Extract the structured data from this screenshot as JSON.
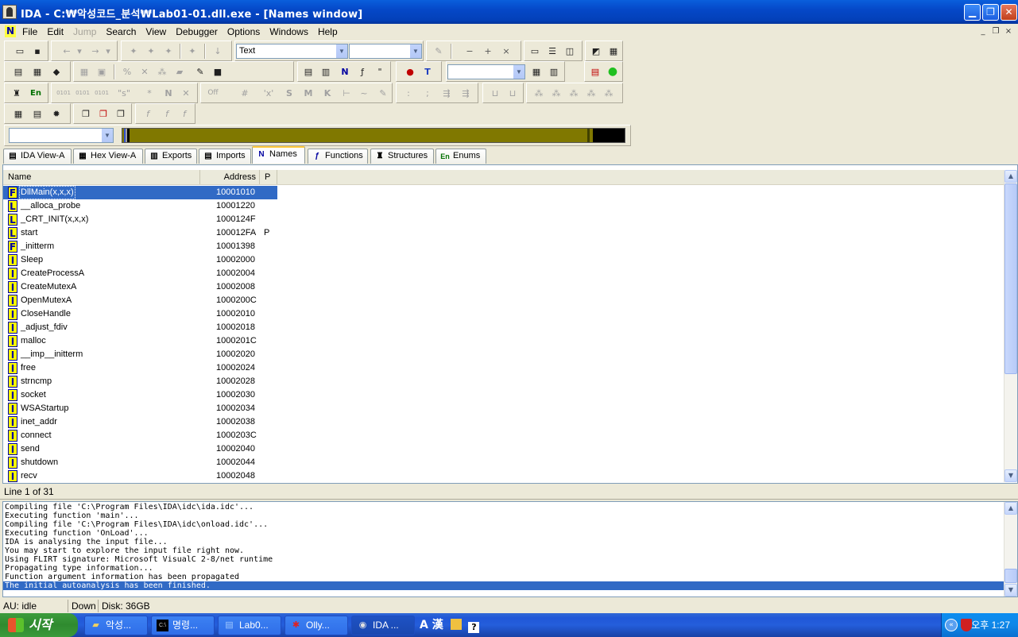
{
  "window": {
    "title": "IDA - C:₩악성코드_분석₩Lab01-01.dll.exe - [Names window]",
    "minimize": "▁",
    "restore": "❐",
    "close": "✕"
  },
  "menu": {
    "items": [
      "File",
      "Edit",
      "Jump",
      "Search",
      "View",
      "Debugger",
      "Options",
      "Windows",
      "Help"
    ],
    "disabled": [
      "Jump"
    ],
    "logo": "N",
    "mdi_minimize": "_",
    "mdi_restore": "❐",
    "mdi_close": "×"
  },
  "toolbar": {
    "segment_combo_value": "Text"
  },
  "tabs": [
    {
      "label": "IDA View-A",
      "icon": "document-icon"
    },
    {
      "label": "Hex View-A",
      "icon": "hex-icon"
    },
    {
      "label": "Exports",
      "icon": "exports-icon"
    },
    {
      "label": "Imports",
      "icon": "imports-icon"
    },
    {
      "label": "Names",
      "icon": "names-icon",
      "active": true
    },
    {
      "label": "Functions",
      "icon": "functions-icon"
    },
    {
      "label": "Structures",
      "icon": "structures-icon"
    },
    {
      "label": "Enums",
      "icon": "enums-icon"
    }
  ],
  "names": {
    "columns": [
      "Name",
      "Address",
      "P"
    ],
    "rows": [
      {
        "type": "F",
        "name": "DllMain(x,x,x)",
        "address": "10001010",
        "p": ""
      },
      {
        "type": "L",
        "name": "__alloca_probe",
        "address": "10001220",
        "p": ""
      },
      {
        "type": "L",
        "name": "_CRT_INIT(x,x,x)",
        "address": "1000124F",
        "p": ""
      },
      {
        "type": "L",
        "name": "start",
        "address": "100012FA",
        "p": "P"
      },
      {
        "type": "F",
        "name": "_initterm",
        "address": "10001398",
        "p": ""
      },
      {
        "type": "I",
        "name": "Sleep",
        "address": "10002000",
        "p": ""
      },
      {
        "type": "I",
        "name": "CreateProcessA",
        "address": "10002004",
        "p": ""
      },
      {
        "type": "I",
        "name": "CreateMutexA",
        "address": "10002008",
        "p": ""
      },
      {
        "type": "I",
        "name": "OpenMutexA",
        "address": "1000200C",
        "p": ""
      },
      {
        "type": "I",
        "name": "CloseHandle",
        "address": "10002010",
        "p": ""
      },
      {
        "type": "I",
        "name": "_adjust_fdiv",
        "address": "10002018",
        "p": ""
      },
      {
        "type": "I",
        "name": "malloc",
        "address": "1000201C",
        "p": ""
      },
      {
        "type": "I",
        "name": "__imp__initterm",
        "address": "10002020",
        "p": ""
      },
      {
        "type": "I",
        "name": "free",
        "address": "10002024",
        "p": ""
      },
      {
        "type": "I",
        "name": "strncmp",
        "address": "10002028",
        "p": ""
      },
      {
        "type": "I",
        "name": "socket",
        "address": "10002030",
        "p": ""
      },
      {
        "type": "I",
        "name": "WSAStartup",
        "address": "10002034",
        "p": ""
      },
      {
        "type": "I",
        "name": "inet_addr",
        "address": "10002038",
        "p": ""
      },
      {
        "type": "I",
        "name": "connect",
        "address": "1000203C",
        "p": ""
      },
      {
        "type": "I",
        "name": "send",
        "address": "10002040",
        "p": ""
      },
      {
        "type": "I",
        "name": "shutdown",
        "address": "10002044",
        "p": ""
      },
      {
        "type": "I",
        "name": "recv",
        "address": "10002048",
        "p": ""
      }
    ],
    "selected_index": 0
  },
  "line_info": "Line 1 of 31",
  "output": {
    "lines": [
      "Compiling file 'C:\\Program Files\\IDA\\idc\\ida.idc'...",
      "Executing function 'main'...",
      "Compiling file 'C:\\Program Files\\IDA\\idc\\onload.idc'...",
      "Executing function 'OnLoad'...",
      "IDA is analysing the input file...",
      "You may start to explore the input file right now.",
      "Using FLIRT signature: Microsoft VisualC 2-8/net runtime",
      "Propagating type information...",
      "Function argument information has been propagated",
      "The initial autoanalysis has been finished."
    ],
    "selected_index": 9
  },
  "status": {
    "au": "AU:  idle",
    "down": "Down",
    "disk": "Disk: 36GB"
  },
  "taskbar": {
    "start": "시작",
    "tasks": [
      {
        "label": "악성...",
        "icon": "folder-icon"
      },
      {
        "label": "명령...",
        "icon": "cmd-icon"
      },
      {
        "label": "Lab0...",
        "icon": "notepad-icon"
      },
      {
        "label": "Olly...",
        "icon": "ollydbg-icon"
      },
      {
        "label": "IDA ...",
        "icon": "ida-icon",
        "active": true
      }
    ],
    "ime": "A 漢",
    "clock": "오후 1:27"
  },
  "colors": {
    "selection": "#316ac5",
    "title_bar": "#0548c8",
    "nav_band": "#807800",
    "name_icon_bg": "#ffff00"
  }
}
